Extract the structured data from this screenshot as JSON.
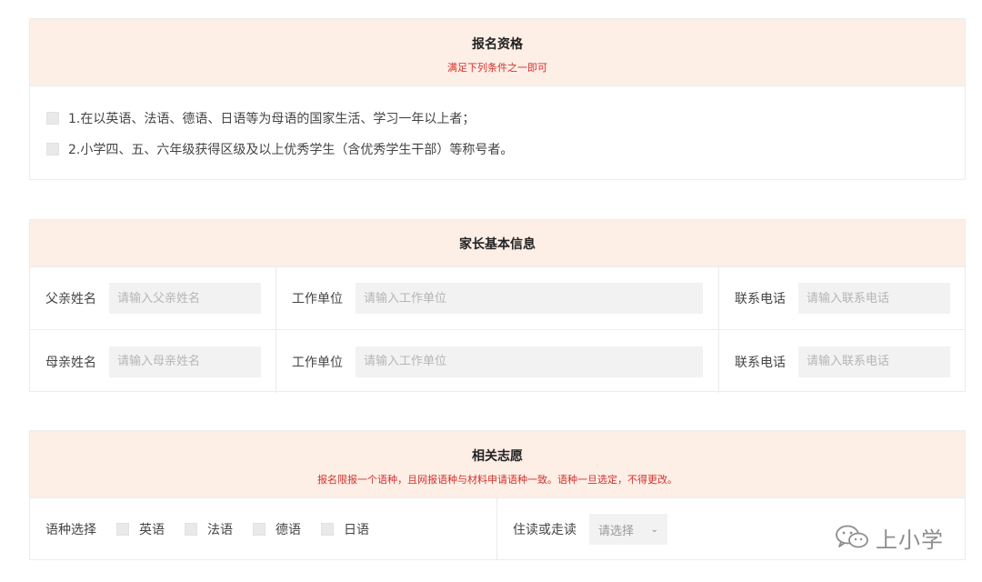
{
  "eligibility": {
    "title": "报名资格",
    "subtitle": "满足下列条件之一即可",
    "conditions": [
      "1.在以英语、法语、德语、日语等为母语的国家生活、学习一年以上者；",
      "2.小学四、五、六年级获得区级及以上优秀学生（含优秀学生干部）等称号者。"
    ]
  },
  "parents": {
    "title": "家长基本信息",
    "rows": [
      {
        "name_label": "父亲姓名",
        "name_placeholder": "请输入父亲姓名",
        "work_label": "工作单位",
        "work_placeholder": "请输入工作单位",
        "phone_label": "联系电话",
        "phone_placeholder": "请输入联系电话"
      },
      {
        "name_label": "母亲姓名",
        "name_placeholder": "请输入母亲姓名",
        "work_label": "工作单位",
        "work_placeholder": "请输入工作单位",
        "phone_label": "联系电话",
        "phone_placeholder": "请输入联系电话"
      }
    ]
  },
  "preference": {
    "title": "相关志愿",
    "subtitle": "报名限报一个语种，且网报语种与材料申请语种一致。语种一旦选定，不得更改。",
    "language_label": "语种选择",
    "languages": [
      "英语",
      "法语",
      "德语",
      "日语"
    ],
    "boarding_label": "住读或走读",
    "boarding_select_value": "请选择"
  },
  "watermark": {
    "text": "上小学",
    "icon": "wechat-icon"
  },
  "colors": {
    "header_bg": "#fdeee6",
    "accent_red": "#d2322d",
    "input_bg": "#f2f2f2"
  }
}
